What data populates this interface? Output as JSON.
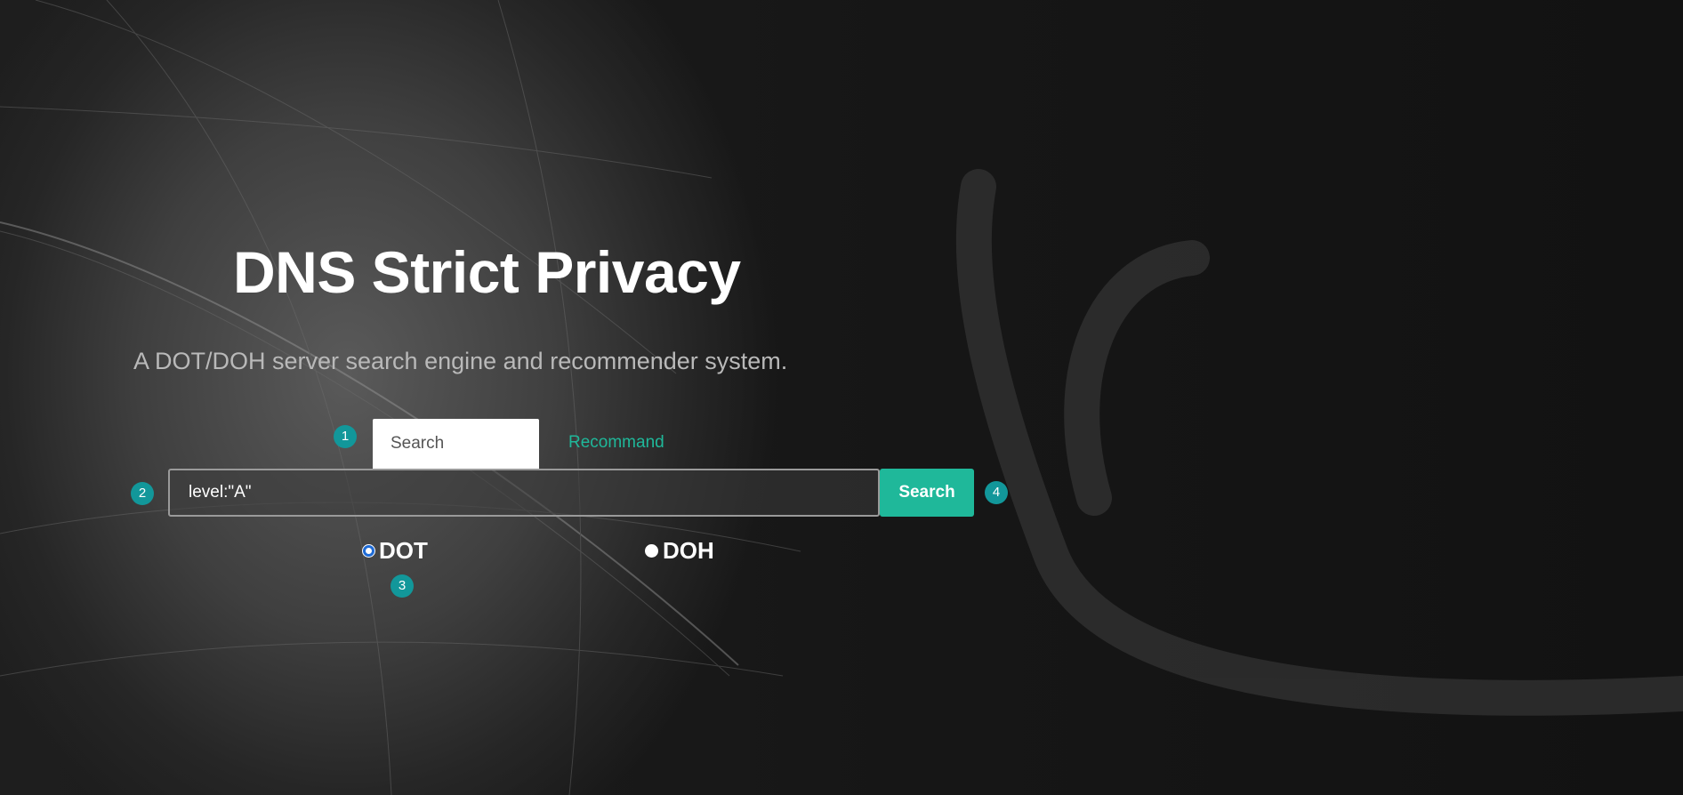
{
  "hero": {
    "title": "DNS Strict Privacy",
    "subtitle": "A DOT/DOH server search engine and recommender system."
  },
  "tabs": [
    {
      "label": "Search",
      "active": true
    },
    {
      "label": "Recommand",
      "active": false
    }
  ],
  "search": {
    "query_value": "level:\"A\"",
    "button_label": "Search"
  },
  "protocol": {
    "options": [
      {
        "label": "DOT",
        "selected": true
      },
      {
        "label": "DOH",
        "selected": false
      }
    ]
  },
  "markers": [
    "1",
    "2",
    "3",
    "4"
  ],
  "colors": {
    "accent": "#1fb89a",
    "marker": "#12979a",
    "radio_selected": "#1e6bd6",
    "title": "#ffffff",
    "subtitle": "#b9b9b9"
  }
}
